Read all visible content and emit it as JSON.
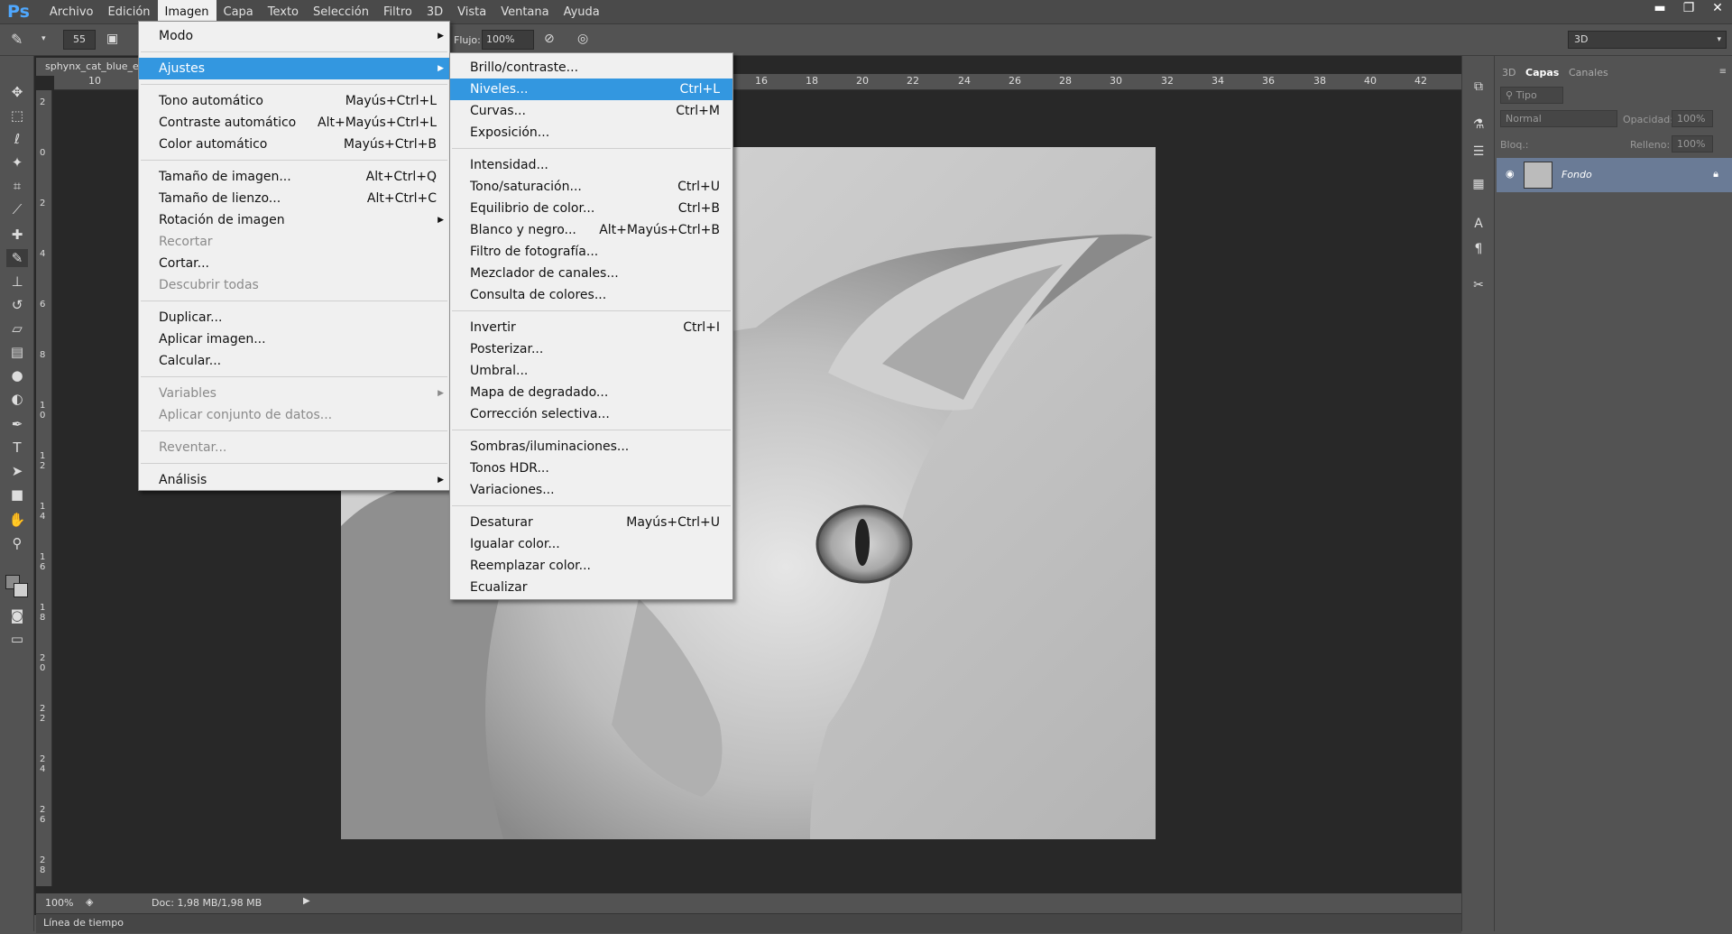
{
  "app": {
    "logo": "Ps"
  },
  "menubar": {
    "items": [
      "Archivo",
      "Edición",
      "Imagen",
      "Capa",
      "Texto",
      "Selección",
      "Filtro",
      "3D",
      "Vista",
      "Ventana",
      "Ayuda"
    ],
    "active": "Imagen"
  },
  "window_controls": {
    "minimize": "▬",
    "restore": "❐",
    "close": "✕"
  },
  "options_bar": {
    "brush_size": "55",
    "flow_label": "Flujo:",
    "flow_value": "100%"
  },
  "workspace": {
    "value": "3D"
  },
  "document": {
    "tab_title": "sphynx_cat_blue_e",
    "zoom": "100%",
    "doc_info": "Doc: 1,98 MB/1,98 MB",
    "timeline_label": "Línea de tiempo"
  },
  "ruler_top": [
    "10",
    "16",
    "18",
    "20",
    "22",
    "24",
    "26",
    "28",
    "30",
    "32",
    "34",
    "36",
    "38",
    "40",
    "42"
  ],
  "ruler_left": [
    "2",
    "0",
    "2",
    "4",
    "6",
    "8",
    "1 0",
    "1 2",
    "1 4",
    "1 6",
    "1 8",
    "2 0",
    "2 2",
    "2 4",
    "2 6",
    "2 8"
  ],
  "imagen_menu": {
    "items": [
      {
        "label": "Modo",
        "shortcut": "",
        "submenu": true,
        "disabled": false
      },
      {
        "sep": true
      },
      {
        "label": "Ajustes",
        "shortcut": "",
        "submenu": true,
        "highlighted": true
      },
      {
        "sep": true
      },
      {
        "label": "Tono automático",
        "shortcut": "Mayús+Ctrl+L"
      },
      {
        "label": "Contraste automático",
        "shortcut": "Alt+Mayús+Ctrl+L"
      },
      {
        "label": "Color automático",
        "shortcut": "Mayús+Ctrl+B"
      },
      {
        "sep": true
      },
      {
        "label": "Tamaño de imagen...",
        "shortcut": "Alt+Ctrl+Q"
      },
      {
        "label": "Tamaño de lienzo...",
        "shortcut": "Alt+Ctrl+C"
      },
      {
        "label": "Rotación de imagen",
        "shortcut": "",
        "submenu": true
      },
      {
        "label": "Recortar",
        "shortcut": "",
        "disabled": true
      },
      {
        "label": "Cortar...",
        "shortcut": ""
      },
      {
        "label": "Descubrir todas",
        "shortcut": "",
        "disabled": true
      },
      {
        "sep": true
      },
      {
        "label": "Duplicar...",
        "shortcut": ""
      },
      {
        "label": "Aplicar imagen...",
        "shortcut": ""
      },
      {
        "label": "Calcular...",
        "shortcut": ""
      },
      {
        "sep": true
      },
      {
        "label": "Variables",
        "shortcut": "",
        "submenu": true,
        "disabled": true
      },
      {
        "label": "Aplicar conjunto de datos...",
        "shortcut": "",
        "disabled": true
      },
      {
        "sep": true
      },
      {
        "label": "Reventar...",
        "shortcut": "",
        "disabled": true
      },
      {
        "sep": true
      },
      {
        "label": "Análisis",
        "shortcut": "",
        "submenu": true
      }
    ]
  },
  "ajustes_menu": {
    "items": [
      {
        "label": "Brillo/contraste...",
        "shortcut": ""
      },
      {
        "label": "Niveles...",
        "shortcut": "Ctrl+L",
        "highlighted": true
      },
      {
        "label": "Curvas...",
        "shortcut": "Ctrl+M"
      },
      {
        "label": "Exposición...",
        "shortcut": ""
      },
      {
        "sep": true
      },
      {
        "label": "Intensidad...",
        "shortcut": ""
      },
      {
        "label": "Tono/saturación...",
        "shortcut": "Ctrl+U"
      },
      {
        "label": "Equilibrio de color...",
        "shortcut": "Ctrl+B"
      },
      {
        "label": "Blanco y negro...",
        "shortcut": "Alt+Mayús+Ctrl+B"
      },
      {
        "label": "Filtro de fotografía...",
        "shortcut": ""
      },
      {
        "label": "Mezclador de canales...",
        "shortcut": ""
      },
      {
        "label": "Consulta de colores...",
        "shortcut": ""
      },
      {
        "sep": true
      },
      {
        "label": "Invertir",
        "shortcut": "Ctrl+I"
      },
      {
        "label": "Posterizar...",
        "shortcut": ""
      },
      {
        "label": "Umbral...",
        "shortcut": ""
      },
      {
        "label": "Mapa de degradado...",
        "shortcut": ""
      },
      {
        "label": "Corrección selectiva...",
        "shortcut": ""
      },
      {
        "sep": true
      },
      {
        "label": "Sombras/iluminaciones...",
        "shortcut": ""
      },
      {
        "label": "Tonos HDR...",
        "shortcut": ""
      },
      {
        "label": "Variaciones...",
        "shortcut": ""
      },
      {
        "sep": true
      },
      {
        "label": "Desaturar",
        "shortcut": "Mayús+Ctrl+U"
      },
      {
        "label": "Igualar color...",
        "shortcut": ""
      },
      {
        "label": "Reemplazar color...",
        "shortcut": ""
      },
      {
        "label": "Ecualizar",
        "shortcut": ""
      }
    ]
  },
  "layers_panel": {
    "tabs": [
      "3D",
      "Capas",
      "Canales"
    ],
    "active_tab": "Capas",
    "filter_kind": "Tipo",
    "blend_mode": "Normal",
    "opacity_label": "Opacidad:",
    "opacity_value": "100%",
    "lock_label": "Bloq.:",
    "fill_label": "Relleno:",
    "fill_value": "100%",
    "layer_name": "Fondo"
  },
  "colors": {
    "menu_highlight": "#3397e0",
    "layer_selected": "#6a7b96",
    "ui_bg": "#535353"
  }
}
